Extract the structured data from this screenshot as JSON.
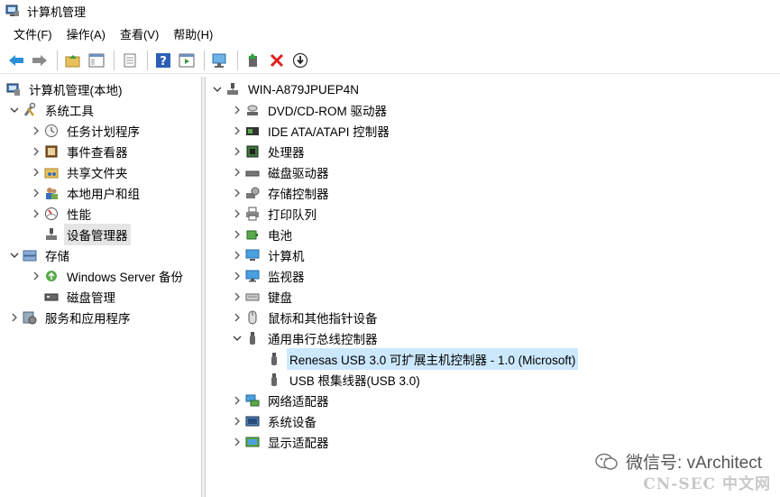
{
  "window": {
    "title": "计算机管理"
  },
  "menu": [
    "文件(F)",
    "操作(A)",
    "查看(V)",
    "帮助(H)"
  ],
  "left_tree": {
    "root": "计算机管理(本地)",
    "system_tools": "系统工具",
    "task_scheduler": "任务计划程序",
    "event_viewer": "事件查看器",
    "shared_folders": "共享文件夹",
    "local_users": "本地用户和组",
    "performance": "性能",
    "device_manager": "设备管理器",
    "storage": "存储",
    "windows_backup": "Windows Server 备份",
    "disk_management": "磁盘管理",
    "services_apps": "服务和应用程序"
  },
  "device_tree": {
    "computer_name": "WIN-A879JPUEP4N",
    "categories": [
      "DVD/CD-ROM 驱动器",
      "IDE ATA/ATAPI 控制器",
      "处理器",
      "磁盘驱动器",
      "存储控制器",
      "打印队列",
      "电池",
      "计算机",
      "监视器",
      "键盘",
      "鼠标和其他指针设备",
      "通用串行总线控制器"
    ],
    "usb_children": [
      "Renesas USB 3.0 可扩展主机控制器 - 1.0 (Microsoft)",
      "USB 根集线器(USB 3.0)"
    ],
    "categories_after": [
      "网络适配器",
      "系统设备",
      "显示适配器"
    ]
  },
  "watermark": {
    "wechat": "微信号: vArchitect",
    "site": "CN-SEC 中文网"
  }
}
